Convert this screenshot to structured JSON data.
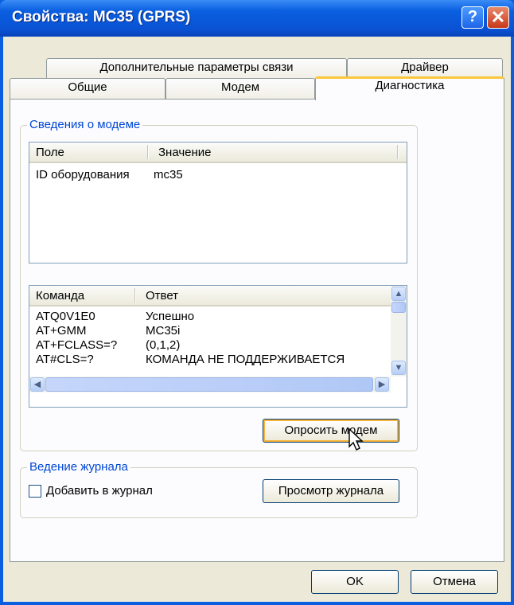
{
  "window": {
    "title": "Свойства: MC35 (GPRS)",
    "help_glyph": "?",
    "close_glyph": "✕"
  },
  "tabs": {
    "row1": [
      "Дополнительные параметры связи",
      "Драйвер"
    ],
    "row2": [
      "Общие",
      "Модем",
      "Диагностика"
    ]
  },
  "modem_info": {
    "legend": "Сведения о модеме",
    "columns": [
      "Поле",
      "Значение"
    ],
    "rows": [
      {
        "field": "ID оборудования",
        "value": "mc35"
      }
    ]
  },
  "commands": {
    "columns": [
      "Команда",
      "Ответ"
    ],
    "rows": [
      {
        "cmd": "ATQ0V1E0",
        "resp": "Успешно"
      },
      {
        "cmd": "AT+GMM",
        "resp": "MC35i"
      },
      {
        "cmd": "AT+FCLASS=?",
        "resp": "(0,1,2)"
      },
      {
        "cmd": "AT#CLS=?",
        "resp": "КОМАНДА НЕ ПОДДЕРЖИВАЕТСЯ"
      }
    ],
    "scroll_up_glyph": "▲",
    "scroll_down_glyph": "▼",
    "scroll_left_glyph": "◀",
    "scroll_right_glyph": "▶"
  },
  "query_button": "Опросить модем",
  "logging": {
    "legend": "Ведение журнала",
    "checkbox_label": "Добавить в журнал",
    "checked": false,
    "view_button": "Просмотр журнала"
  },
  "footer": {
    "ok": "OK",
    "cancel": "Отмена"
  },
  "colors": {
    "title_bar": "#0a5fe0",
    "dialog_bg": "#ece9d8",
    "legend_text": "#0046d5",
    "active_tab_accent": "#ffc83c"
  },
  "icons": {
    "help": "question-mark",
    "close": "x-mark",
    "cursor": "arrow-pointer"
  }
}
